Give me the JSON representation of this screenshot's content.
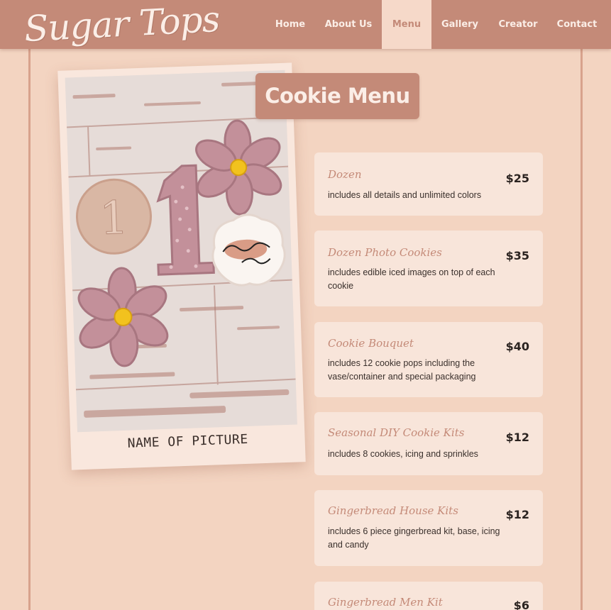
{
  "header": {
    "logo": "Sugar Tops",
    "nav": [
      {
        "label": "Home",
        "active": false
      },
      {
        "label": "About Us",
        "active": false
      },
      {
        "label": "Menu",
        "active": true
      },
      {
        "label": "Gallery",
        "active": false
      },
      {
        "label": "Creator",
        "active": false
      },
      {
        "label": "Contact",
        "active": false
      }
    ]
  },
  "main": {
    "title": "Cookie Menu",
    "photo_caption": "NAME OF PICTURE",
    "photo_content": {
      "number_cookie": "1"
    },
    "items": [
      {
        "name": "Dozen",
        "description": "includes all details and unlimited colors",
        "price": "$25"
      },
      {
        "name": "Dozen Photo Cookies",
        "description": "includes edible iced images on top of each cookie",
        "price": "$35"
      },
      {
        "name": "Cookie Bouquet",
        "description": "includes 12 cookie pops including the vase/container and special packaging",
        "price": "$40"
      },
      {
        "name": "Seasonal DIY Cookie Kits",
        "description": "includes 8 cookies, icing and sprinkles",
        "price": "$12"
      },
      {
        "name": "Gingerbread House Kits",
        "description": "includes 6 piece gingerbread kit, base, icing and candy",
        "price": "$12"
      },
      {
        "name": "Gingerbread Men Kit",
        "description": "",
        "price": "$6"
      }
    ]
  },
  "colors": {
    "brand": "#c48a78",
    "background": "#f3d4c1",
    "card": "#f8e5da"
  }
}
